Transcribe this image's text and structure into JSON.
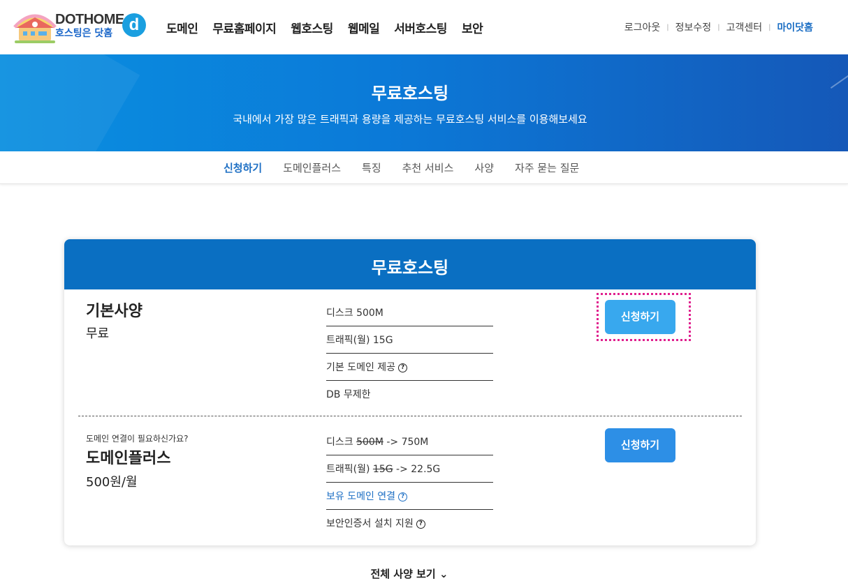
{
  "header": {
    "logo_title": "DOTHOME",
    "logo_sub": "호스팅은 닷홈",
    "logo_mark": "d",
    "gnb": [
      "도메인",
      "무료홈페이지",
      "웹호스팅",
      "웹메일",
      "서버호스팅",
      "보안"
    ],
    "util": {
      "logout": "로그아웃",
      "edit_info": "정보수정",
      "support": "고객센터",
      "mydothome": "마이닷홈"
    }
  },
  "banner": {
    "title": "무료호스팅",
    "subtitle": "국내에서 가장 많은 트래픽과 용량을 제공하는 무료호스팅 서비스를 이용해보세요"
  },
  "subnav": [
    "신청하기",
    "도메인플러스",
    "특징",
    "추천 서비스",
    "사양",
    "자주 묻는 질문"
  ],
  "card": {
    "title": "무료호스팅",
    "basic": {
      "name": "기본사양",
      "price": "무료",
      "specs": [
        "디스크 500M",
        "트래픽(월) 15G",
        "기본 도메인 제공",
        "DB 무제한"
      ],
      "button": "신청하기"
    },
    "plus": {
      "note": "도메인 연결이 필요하신가요?",
      "name": "도메인플러스",
      "price": "500원/월",
      "disk_label": "디스크 ",
      "disk_old": "500M",
      "disk_new": " -> 750M",
      "traffic_label": "트래픽(월) ",
      "traffic_old": "15G",
      "traffic_new": " -> 22.5G",
      "domain_link": "보유 도메인 연결",
      "ssl": "보안인증서 설치 지원",
      "button": "신청하기"
    }
  },
  "more_link": "전체 사양 보기",
  "icons": {
    "help": "?",
    "chevron": "⌄"
  },
  "colors": {
    "brand_blue": "#0a6fc2",
    "button_blue": "#2d8fe6",
    "link_blue": "#1d6fc4",
    "focus_pink": "#e0208e"
  }
}
